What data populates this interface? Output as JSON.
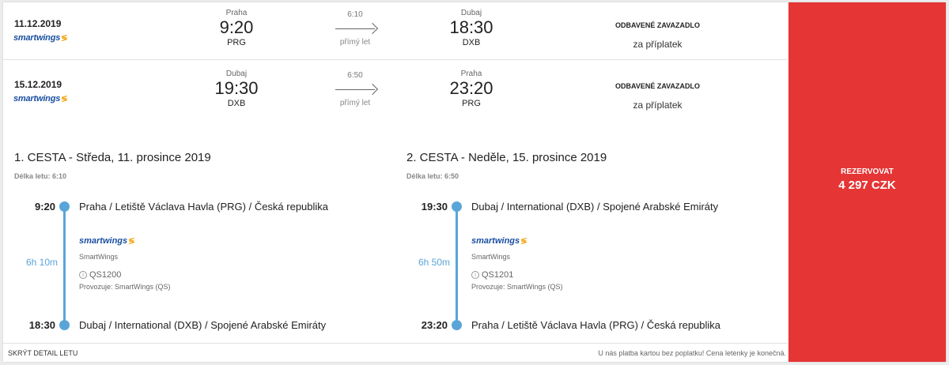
{
  "outbound": {
    "date": "11.12.2019",
    "airline_logo": "smartwings",
    "dep": {
      "city": "Praha",
      "time": "9:20",
      "code": "PRG"
    },
    "duration": "6:10",
    "direct": "přímý let",
    "arr": {
      "city": "Dubaj",
      "time": "18:30",
      "code": "DXB"
    },
    "baggage_title": "ODBAVENÉ ZAVAZADLO",
    "baggage_sub": "za příplatek"
  },
  "inbound": {
    "date": "15.12.2019",
    "airline_logo": "smartwings",
    "dep": {
      "city": "Dubaj",
      "time": "19:30",
      "code": "DXB"
    },
    "duration": "6:50",
    "direct": "přímý let",
    "arr": {
      "city": "Praha",
      "time": "23:20",
      "code": "PRG"
    },
    "baggage_title": "ODBAVENÉ ZAVAZADLO",
    "baggage_sub": "za příplatek"
  },
  "legs": [
    {
      "title": "1. CESTA - Středa, 11. prosince 2019",
      "length": "Délka letu: 6:10",
      "dep_time": "9:20",
      "dep_place": "Praha / Letiště Václava Havla (PRG) / Česká republika",
      "flight_duration": "6h 10m",
      "airline_logo": "smartwings",
      "airline_name": "SmartWings",
      "flight_no": "QS1200",
      "operated_by": "Provozuje: SmartWings (QS)",
      "arr_time": "18:30",
      "arr_place": "Dubaj / International (DXB) / Spojené Arabské Emiráty"
    },
    {
      "title": "2. CESTA - Neděle, 15. prosince 2019",
      "length": "Délka letu: 6:50",
      "dep_time": "19:30",
      "dep_place": "Dubaj / International (DXB) / Spojené Arabské Emiráty",
      "flight_duration": "6h 50m",
      "airline_logo": "smartwings",
      "airline_name": "SmartWings",
      "flight_no": "QS1201",
      "operated_by": "Provozuje: SmartWings (QS)",
      "arr_time": "23:20",
      "arr_place": "Praha / Letiště Václava Havla (PRG) / Česká republika"
    }
  ],
  "footer": {
    "hide_detail": "SKRÝT DETAIL LETU",
    "note": "U nás platba kartou bez poplatku! Cena letenky je konečná."
  },
  "booking": {
    "label": "REZERVOVAT",
    "price": "4 297 CZK",
    "color": "#e53535"
  },
  "colors": {
    "timeline": "#5aa5d8",
    "logo_blue": "#1a4fa0",
    "logo_flag": "#f3a712"
  }
}
